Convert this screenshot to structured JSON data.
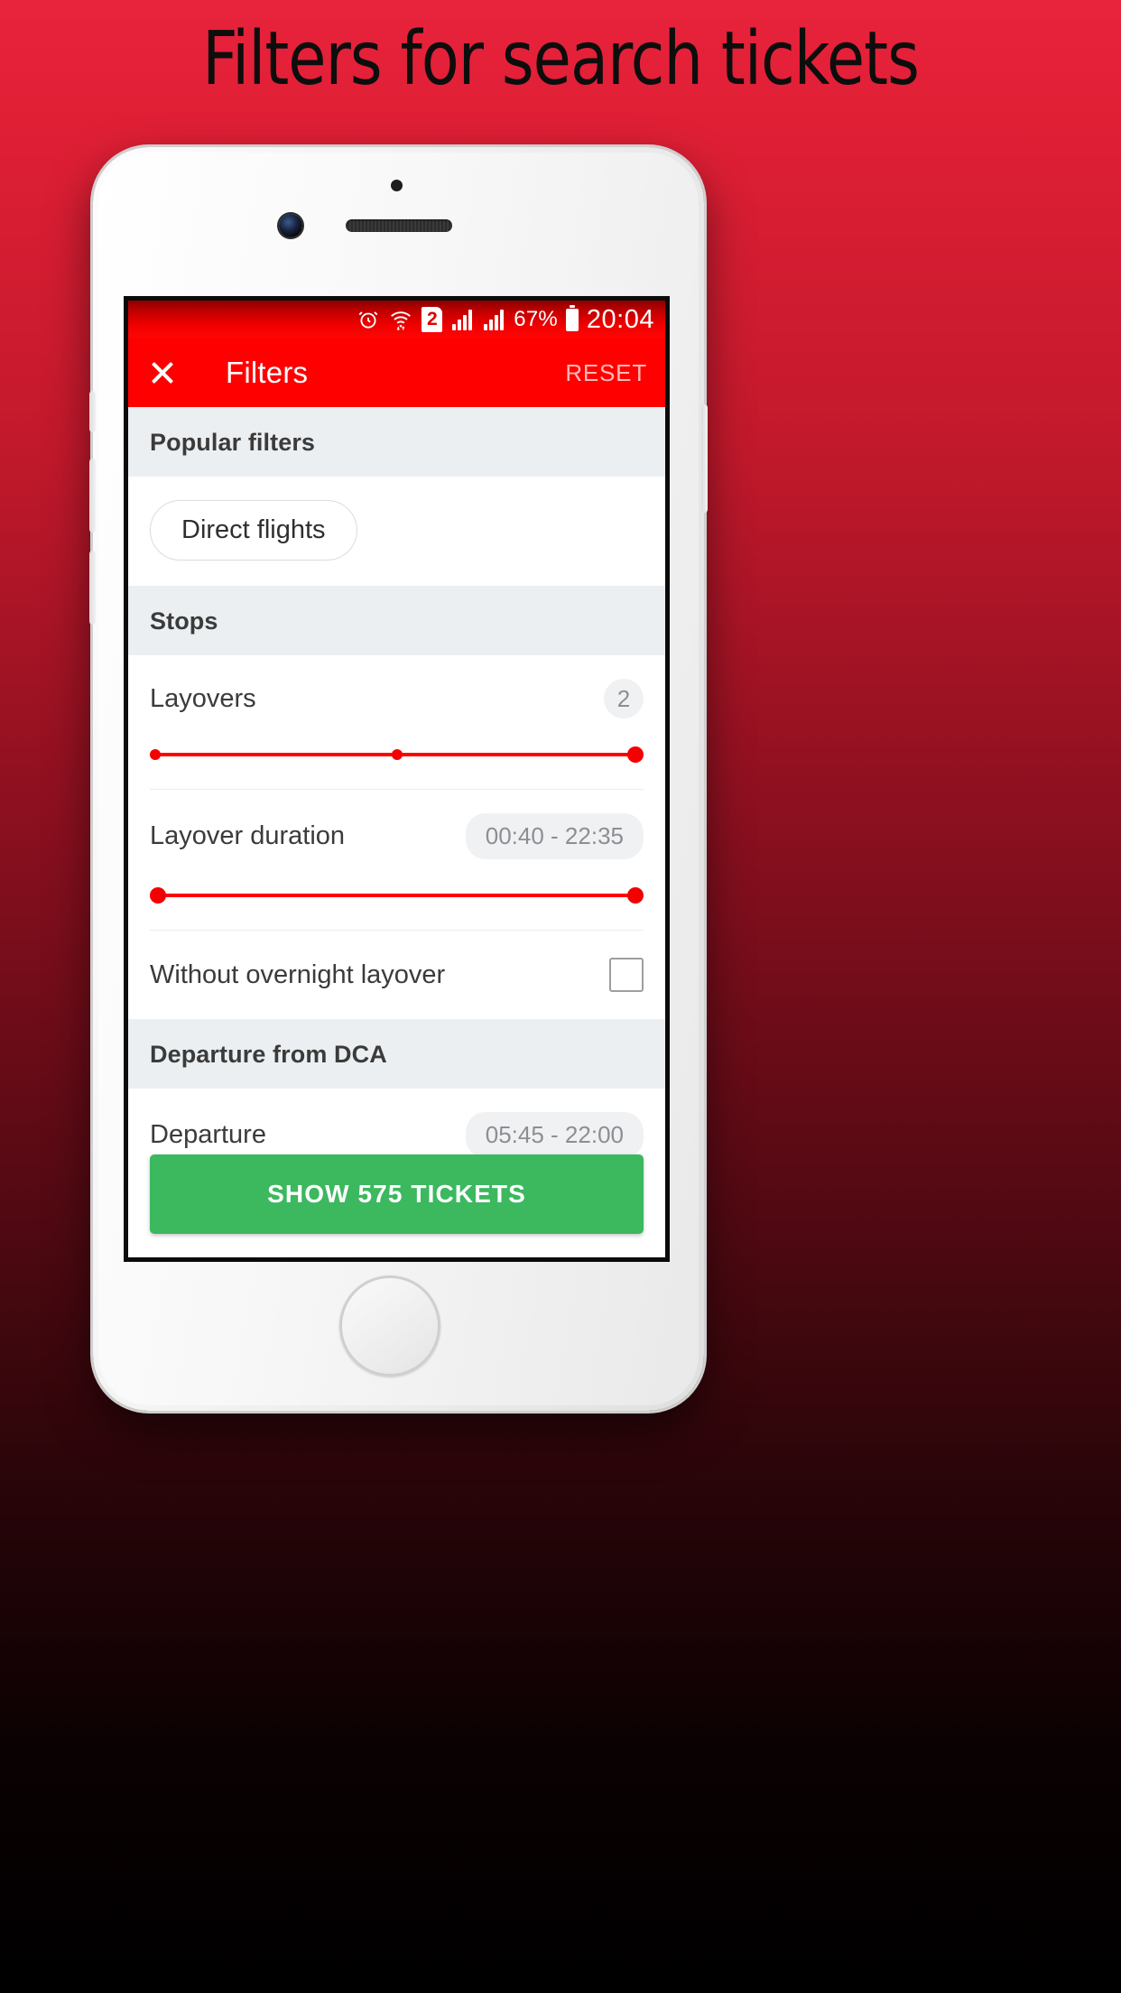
{
  "promo": {
    "title": "Filters for search tickets"
  },
  "status_bar": {
    "alarm_icon": "alarm-clock-icon",
    "wifi_icon": "wifi-icon",
    "sim_badge": "2",
    "signal_icon_1": "signal-bars-icon",
    "signal_icon_2": "signal-bars-icon",
    "battery_percent": "67%",
    "battery_icon": "battery-icon",
    "time": "20:04"
  },
  "app_bar": {
    "close_icon": "close-icon",
    "title": "Filters",
    "reset_label": "RESET"
  },
  "sections": {
    "popular_filters": {
      "header": "Popular filters",
      "chips": [
        {
          "label": "Direct flights"
        }
      ]
    },
    "stops": {
      "header": "Stops",
      "layovers": {
        "label": "Layovers",
        "value": "2"
      },
      "layover_duration": {
        "label": "Layover duration",
        "value": "00:40 - 22:35"
      },
      "without_overnight": {
        "label": "Without overnight layover",
        "checked": false
      }
    },
    "departure": {
      "header": "Departure from DCA",
      "departure_time": {
        "label": "Departure",
        "value": "05:45 - 22:00"
      }
    }
  },
  "cta": {
    "label": "SHOW 575 TICKETS"
  },
  "colors": {
    "brand_red": "#ff0000",
    "cta_green": "#3cb85f",
    "section_bg": "#eceff1",
    "slider_red": "#f50000"
  }
}
